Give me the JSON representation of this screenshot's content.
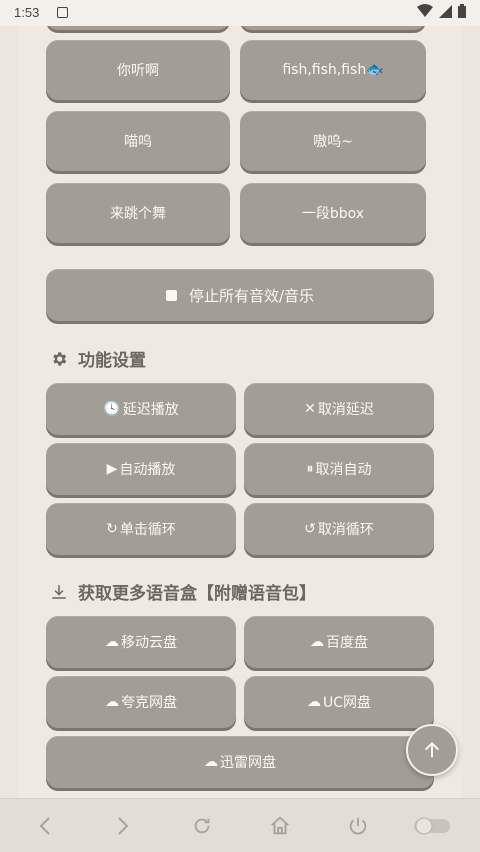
{
  "status": {
    "time": "1:53"
  },
  "sound_buttons": [
    {
      "label": "你听啊"
    },
    {
      "label": "fish,fish,fish🐟"
    },
    {
      "label": "喵呜"
    },
    {
      "label": "嗷呜~"
    },
    {
      "label": "来跳个舞"
    },
    {
      "label": "一段bbox"
    }
  ],
  "stop_button": {
    "label": "停止所有音效/音乐"
  },
  "function_section": {
    "title": "功能设置",
    "buttons": [
      {
        "icon": "🕓",
        "label": "延迟播放"
      },
      {
        "icon": "✕",
        "label": "取消延迟"
      },
      {
        "icon": "▶",
        "label": "自动播放"
      },
      {
        "icon": "⏸",
        "label": "取消自动"
      },
      {
        "icon": "↻",
        "label": "单击循环"
      },
      {
        "icon": "↺",
        "label": "取消循环"
      }
    ]
  },
  "download_section": {
    "title": "获取更多语音盒【附赠语音包】",
    "buttons": [
      {
        "icon": "☁",
        "label": "移动云盘"
      },
      {
        "icon": "☁",
        "label": "百度盘"
      },
      {
        "icon": "☁",
        "label": "夸克网盘"
      },
      {
        "icon": "☁",
        "label": "UC网盘"
      },
      {
        "icon": "☁",
        "label": "迅雷网盘"
      }
    ]
  },
  "colors": {
    "button": "#a39d95",
    "background": "#ece6de",
    "text_light": "#fbf8f4"
  },
  "icons": {
    "fab": "arrow-up-icon",
    "nav": [
      "back-icon",
      "forward-icon",
      "refresh-icon",
      "home-icon",
      "power-icon",
      "toggle-icon"
    ]
  }
}
